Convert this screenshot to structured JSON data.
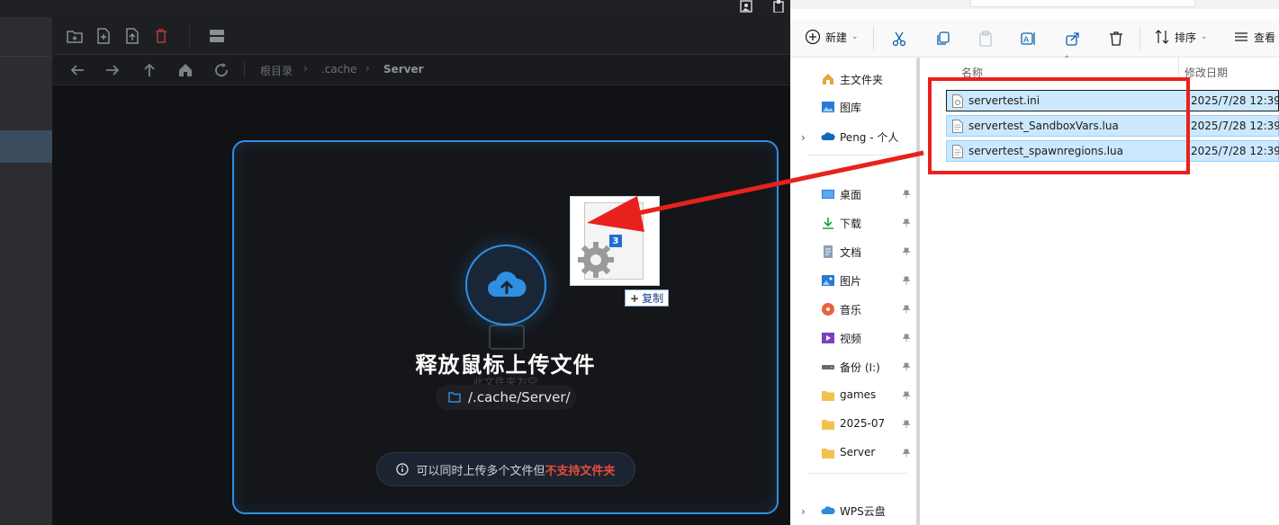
{
  "app": {
    "breadcrumb": [
      "根目录",
      ".cache",
      "Server"
    ],
    "breadcrumb_sep": "›",
    "dropzone": {
      "title": "释放鼠标上传文件",
      "empty_text": "此文件夹为空",
      "path": "/.cache/Server/",
      "hint_prefix": "可以同时上传多个文件但",
      "hint_warning": "不支持文件夹"
    }
  },
  "drag_ghost": {
    "count": "3",
    "copy_label": "复制"
  },
  "explorer": {
    "commands": {
      "new": "新建",
      "sort": "排序",
      "view": "查看"
    },
    "nav": [
      {
        "label": "主文件夹",
        "icon": "home-icon",
        "pinned": false
      },
      {
        "label": "图库",
        "icon": "gallery-icon",
        "pinned": false
      },
      {
        "label": "Peng - 个人",
        "icon": "onedrive-icon",
        "pinned": false,
        "expandable": true
      },
      {
        "label": "桌面",
        "icon": "desktop-icon",
        "pinned": true
      },
      {
        "label": "下载",
        "icon": "download-icon",
        "pinned": true
      },
      {
        "label": "文档",
        "icon": "documents-icon",
        "pinned": true
      },
      {
        "label": "图片",
        "icon": "pictures-icon",
        "pinned": true
      },
      {
        "label": "音乐",
        "icon": "music-icon",
        "pinned": true
      },
      {
        "label": "视频",
        "icon": "videos-icon",
        "pinned": true
      },
      {
        "label": "备份 (I:)",
        "icon": "drive-icon",
        "pinned": true
      },
      {
        "label": "games",
        "icon": "folder-icon",
        "pinned": true
      },
      {
        "label": "2025-07",
        "icon": "folder-icon",
        "pinned": true
      },
      {
        "label": "Server",
        "icon": "folder-icon",
        "pinned": true
      },
      {
        "label": "WPS云盘",
        "icon": "wps-cloud-icon",
        "pinned": false,
        "expandable": true
      }
    ],
    "columns": {
      "name": "名称",
      "modified": "修改日期"
    },
    "files": [
      {
        "name": "servertest.ini",
        "modified": "2025/7/28 12:39",
        "icon": "ini-file-icon"
      },
      {
        "name": "servertest_SandboxVars.lua",
        "modified": "2025/7/28 12:39",
        "icon": "text-file-icon"
      },
      {
        "name": "servertest_spawnregions.lua",
        "modified": "2025/7/28 12:39",
        "icon": "text-file-icon"
      }
    ]
  },
  "colors": {
    "accent_blue": "#2f8fe3",
    "annotation_red": "#e8211c",
    "warning_red": "#e84b3c",
    "selection": "#cce8ff"
  }
}
